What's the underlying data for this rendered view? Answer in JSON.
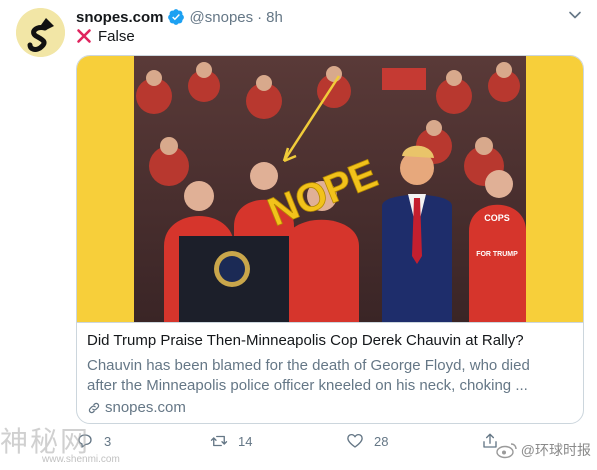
{
  "tweet": {
    "author_name": "snopes.com",
    "handle": "@snopes",
    "separator": "·",
    "time": "8h",
    "text": "False",
    "card": {
      "title": "Did Trump Praise Then-Minneapolis Cop Derek Chauvin at Rally?",
      "description_line1": "Chauvin has been blamed for the death of George Floyd, who died",
      "description_line2": "after the Minneapolis police officer kneeled on his neck, choking ...",
      "domain": "snopes.com",
      "image_overlay_text": "NOPE",
      "banner_top": "COPS",
      "banner_bottom": "FOR TRUMP"
    },
    "actions": {
      "reply_count": "3",
      "retweet_count": "14",
      "like_count": "28"
    }
  },
  "watermark": {
    "left_text": "神秘网",
    "left_subtext": "www.shenmi.com",
    "right_text": "@环球时报"
  },
  "colors": {
    "verified_blue": "#1da1f2",
    "false_red": "#e0245e",
    "card_border": "#ccd6dd",
    "media_yellow": "#f7cf3a",
    "secondary_text": "#657786"
  },
  "icons": {
    "verified": "verified-badge-icon",
    "caret": "chevron-down-icon",
    "false": "x-mark-icon",
    "link": "link-icon",
    "reply": "reply-icon",
    "retweet": "retweet-icon",
    "like": "heart-icon",
    "share": "share-icon"
  }
}
